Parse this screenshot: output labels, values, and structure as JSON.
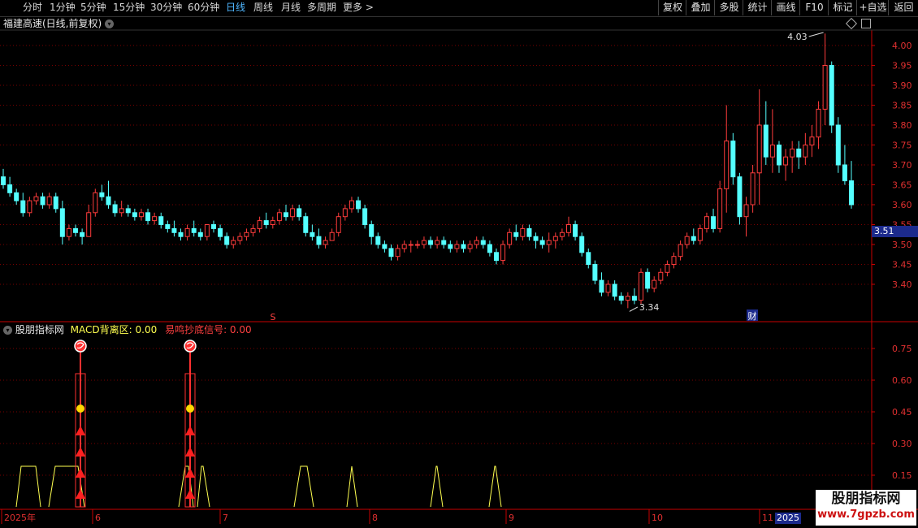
{
  "toolbar": {
    "periods": [
      {
        "label": "分时",
        "active": false
      },
      {
        "label": "1分钟",
        "active": false
      },
      {
        "label": "5分钟",
        "active": false
      },
      {
        "label": "15分钟",
        "active": false
      },
      {
        "label": "30分钟",
        "active": false
      },
      {
        "label": "60分钟",
        "active": false
      },
      {
        "label": "日线",
        "active": true
      },
      {
        "label": "周线",
        "active": false
      },
      {
        "label": "月线",
        "active": false
      },
      {
        "label": "多周期",
        "active": false
      },
      {
        "label": "更多",
        "active": false
      }
    ],
    "more_arrow": ">",
    "right_buttons": [
      "复权",
      "叠加",
      "多股",
      "统计",
      "画线",
      "F10",
      "标记",
      "+自选",
      "返回"
    ]
  },
  "main_chart": {
    "title": "福建高速(日线,前复权)",
    "y_ticks": [
      "4.00",
      "3.95",
      "3.90",
      "3.85",
      "3.80",
      "3.75",
      "3.70",
      "3.65",
      "3.60",
      "3.55",
      "3.50",
      "3.45",
      "3.40"
    ],
    "high_label": "4.03",
    "low_label": "3.34",
    "current_price": "3.51",
    "marker_s": "S",
    "marker_cai": "财"
  },
  "indicator": {
    "name": "股朋指标网",
    "macd_label": "MACD背离区: 0.00",
    "signal_label": "易鸣抄底信号: 0.00",
    "y_ticks": [
      "0.75",
      "0.60",
      "0.45",
      "0.30",
      "0.15"
    ]
  },
  "x_axis": {
    "labels": [
      "2025年",
      "6",
      "7",
      "8",
      "9",
      "10",
      "11"
    ],
    "current_date": "2025"
  },
  "watermark": {
    "line1": "股朋指标网",
    "line2": "www.7gpzb.com"
  },
  "colors": {
    "up": "#ff3c3c",
    "down": "#54ffff",
    "grid": "#7a0000",
    "axis": "#c80000",
    "yellow": "#ffff50",
    "selected": "#1c2a8c"
  },
  "chart_data": {
    "type": "candlestick",
    "ylim": [
      3.3,
      4.05
    ],
    "candles": [
      [
        3.67,
        3.69,
        3.64,
        3.65
      ],
      [
        3.65,
        3.67,
        3.62,
        3.63
      ],
      [
        3.63,
        3.64,
        3.6,
        3.61
      ],
      [
        3.61,
        3.63,
        3.57,
        3.58
      ],
      [
        3.58,
        3.62,
        3.57,
        3.61
      ],
      [
        3.61,
        3.63,
        3.6,
        3.62
      ],
      [
        3.62,
        3.63,
        3.59,
        3.6
      ],
      [
        3.6,
        3.63,
        3.59,
        3.62
      ],
      [
        3.62,
        3.63,
        3.58,
        3.59
      ],
      [
        3.59,
        3.61,
        3.5,
        3.52
      ],
      [
        3.52,
        3.55,
        3.51,
        3.54
      ],
      [
        3.54,
        3.55,
        3.52,
        3.53
      ],
      [
        3.53,
        3.54,
        3.5,
        3.52
      ],
      [
        3.52,
        3.6,
        3.52,
        3.58
      ],
      [
        3.58,
        3.64,
        3.57,
        3.63
      ],
      [
        3.63,
        3.65,
        3.61,
        3.62
      ],
      [
        3.62,
        3.66,
        3.59,
        3.6
      ],
      [
        3.6,
        3.61,
        3.57,
        3.58
      ],
      [
        3.58,
        3.61,
        3.57,
        3.59
      ],
      [
        3.59,
        3.6,
        3.57,
        3.58
      ],
      [
        3.58,
        3.59,
        3.56,
        3.57
      ],
      [
        3.57,
        3.59,
        3.56,
        3.58
      ],
      [
        3.58,
        3.59,
        3.55,
        3.56
      ],
      [
        3.56,
        3.58,
        3.55,
        3.57
      ],
      [
        3.57,
        3.58,
        3.54,
        3.55
      ],
      [
        3.55,
        3.56,
        3.53,
        3.54
      ],
      [
        3.54,
        3.56,
        3.52,
        3.53
      ],
      [
        3.53,
        3.54,
        3.51,
        3.52
      ],
      [
        3.52,
        3.55,
        3.51,
        3.54
      ],
      [
        3.54,
        3.56,
        3.52,
        3.53
      ],
      [
        3.53,
        3.54,
        3.51,
        3.52
      ],
      [
        3.52,
        3.55,
        3.51,
        3.55
      ],
      [
        3.55,
        3.56,
        3.53,
        3.54
      ],
      [
        3.54,
        3.55,
        3.51,
        3.52
      ],
      [
        3.52,
        3.53,
        3.49,
        3.5
      ],
      [
        3.5,
        3.52,
        3.49,
        3.51
      ],
      [
        3.51,
        3.53,
        3.5,
        3.52
      ],
      [
        3.52,
        3.54,
        3.51,
        3.53
      ],
      [
        3.53,
        3.55,
        3.52,
        3.54
      ],
      [
        3.54,
        3.57,
        3.53,
        3.56
      ],
      [
        3.56,
        3.58,
        3.54,
        3.55
      ],
      [
        3.55,
        3.57,
        3.54,
        3.56
      ],
      [
        3.56,
        3.59,
        3.55,
        3.58
      ],
      [
        3.58,
        3.6,
        3.56,
        3.57
      ],
      [
        3.57,
        3.6,
        3.56,
        3.59
      ],
      [
        3.59,
        3.6,
        3.56,
        3.57
      ],
      [
        3.57,
        3.58,
        3.52,
        3.53
      ],
      [
        3.53,
        3.55,
        3.51,
        3.52
      ],
      [
        3.52,
        3.54,
        3.49,
        3.5
      ],
      [
        3.5,
        3.52,
        3.49,
        3.51
      ],
      [
        3.51,
        3.54,
        3.51,
        3.53
      ],
      [
        3.53,
        3.58,
        3.52,
        3.57
      ],
      [
        3.57,
        3.6,
        3.56,
        3.59
      ],
      [
        3.59,
        3.62,
        3.58,
        3.61
      ],
      [
        3.61,
        3.62,
        3.58,
        3.59
      ],
      [
        3.59,
        3.6,
        3.54,
        3.55
      ],
      [
        3.55,
        3.56,
        3.5,
        3.52
      ],
      [
        3.52,
        3.53,
        3.49,
        3.5
      ],
      [
        3.5,
        3.51,
        3.48,
        3.49
      ],
      [
        3.49,
        3.5,
        3.46,
        3.47
      ],
      [
        3.47,
        3.5,
        3.46,
        3.49
      ],
      [
        3.49,
        3.51,
        3.48,
        3.5
      ],
      [
        3.5,
        3.51,
        3.48,
        3.5
      ],
      [
        3.5,
        3.51,
        3.49,
        3.5
      ],
      [
        3.5,
        3.52,
        3.49,
        3.51
      ],
      [
        3.51,
        3.52,
        3.49,
        3.5
      ],
      [
        3.5,
        3.52,
        3.49,
        3.51
      ],
      [
        3.51,
        3.52,
        3.49,
        3.5
      ],
      [
        3.5,
        3.51,
        3.48,
        3.49
      ],
      [
        3.49,
        3.51,
        3.48,
        3.5
      ],
      [
        3.5,
        3.51,
        3.48,
        3.49
      ],
      [
        3.49,
        3.51,
        3.48,
        3.5
      ],
      [
        3.5,
        3.52,
        3.49,
        3.51
      ],
      [
        3.51,
        3.52,
        3.49,
        3.5
      ],
      [
        3.5,
        3.51,
        3.47,
        3.48
      ],
      [
        3.48,
        3.49,
        3.45,
        3.46
      ],
      [
        3.46,
        3.51,
        3.45,
        3.5
      ],
      [
        3.5,
        3.54,
        3.49,
        3.53
      ],
      [
        3.53,
        3.55,
        3.51,
        3.52
      ],
      [
        3.52,
        3.55,
        3.51,
        3.54
      ],
      [
        3.54,
        3.55,
        3.51,
        3.52
      ],
      [
        3.52,
        3.53,
        3.49,
        3.51
      ],
      [
        3.51,
        3.52,
        3.49,
        3.5
      ],
      [
        3.5,
        3.53,
        3.48,
        3.51
      ],
      [
        3.51,
        3.53,
        3.49,
        3.52
      ],
      [
        3.52,
        3.54,
        3.51,
        3.53
      ],
      [
        3.53,
        3.57,
        3.52,
        3.55
      ],
      [
        3.55,
        3.56,
        3.51,
        3.52
      ],
      [
        3.52,
        3.53,
        3.47,
        3.48
      ],
      [
        3.48,
        3.49,
        3.44,
        3.45
      ],
      [
        3.45,
        3.46,
        3.4,
        3.41
      ],
      [
        3.41,
        3.43,
        3.37,
        3.38
      ],
      [
        3.38,
        3.41,
        3.37,
        3.4
      ],
      [
        3.4,
        3.41,
        3.36,
        3.37
      ],
      [
        3.37,
        3.38,
        3.35,
        3.36
      ],
      [
        3.36,
        3.38,
        3.34,
        3.37
      ],
      [
        3.37,
        3.39,
        3.35,
        3.36
      ],
      [
        3.36,
        3.44,
        3.35,
        3.43
      ],
      [
        3.43,
        3.44,
        3.38,
        3.39
      ],
      [
        3.39,
        3.42,
        3.38,
        3.41
      ],
      [
        3.41,
        3.44,
        3.4,
        3.43
      ],
      [
        3.43,
        3.46,
        3.42,
        3.45
      ],
      [
        3.45,
        3.48,
        3.44,
        3.47
      ],
      [
        3.47,
        3.51,
        3.46,
        3.5
      ],
      [
        3.5,
        3.53,
        3.49,
        3.52
      ],
      [
        3.52,
        3.54,
        3.5,
        3.51
      ],
      [
        3.51,
        3.55,
        3.5,
        3.54
      ],
      [
        3.54,
        3.58,
        3.53,
        3.57
      ],
      [
        3.57,
        3.59,
        3.53,
        3.54
      ],
      [
        3.54,
        3.66,
        3.53,
        3.64
      ],
      [
        3.64,
        3.85,
        3.58,
        3.76
      ],
      [
        3.76,
        3.78,
        3.65,
        3.67
      ],
      [
        3.67,
        3.68,
        3.55,
        3.57
      ],
      [
        3.57,
        3.62,
        3.52,
        3.6
      ],
      [
        3.6,
        3.7,
        3.58,
        3.68
      ],
      [
        3.68,
        3.89,
        3.6,
        3.8
      ],
      [
        3.8,
        3.86,
        3.7,
        3.72
      ],
      [
        3.72,
        3.84,
        3.68,
        3.75
      ],
      [
        3.75,
        3.76,
        3.68,
        3.7
      ],
      [
        3.7,
        3.74,
        3.66,
        3.72
      ],
      [
        3.72,
        3.76,
        3.68,
        3.74
      ],
      [
        3.74,
        3.76,
        3.69,
        3.72
      ],
      [
        3.72,
        3.78,
        3.7,
        3.75
      ],
      [
        3.75,
        3.8,
        3.72,
        3.77
      ],
      [
        3.77,
        3.86,
        3.74,
        3.84
      ],
      [
        3.84,
        4.03,
        3.8,
        3.95
      ],
      [
        3.95,
        3.96,
        3.78,
        3.8
      ],
      [
        3.8,
        3.82,
        3.68,
        3.7
      ],
      [
        3.7,
        3.75,
        3.65,
        3.66
      ],
      [
        3.66,
        3.71,
        3.59,
        3.6
      ]
    ],
    "signal_positions": [
      [
        0.27,
        "6"
      ],
      [
        0.69,
        "6/7"
      ]
    ],
    "yellow_pulses": [
      0.0,
      0.09,
      0.2,
      0.67,
      1.08,
      1.29,
      1.53,
      1.77
    ]
  }
}
